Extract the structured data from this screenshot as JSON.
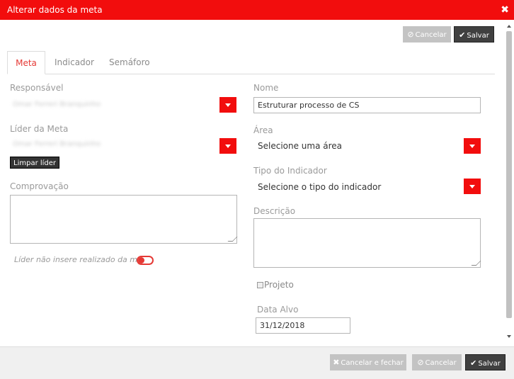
{
  "window": {
    "title": "Alterar dados da meta",
    "close_glyph": "✖"
  },
  "top_actions": {
    "cancel_label": "Cancelar",
    "save_label": "Salvar"
  },
  "tabs": [
    {
      "label": "Meta",
      "active": true
    },
    {
      "label": "Indicador",
      "active": false
    },
    {
      "label": "Semáforo",
      "active": false
    }
  ],
  "form": {
    "responsavel": {
      "label": "Responsável",
      "value": "Omar Ferreri Branquinho"
    },
    "lider": {
      "label": "Líder da Meta",
      "value": "Omar Ferreri Branquinho",
      "clear_label": "Limpar líder"
    },
    "comprovacao": {
      "label": "Comprovação",
      "value": ""
    },
    "toggle": {
      "label": "Líder não insere realizado da meta",
      "on": false
    },
    "nome": {
      "label": "Nome",
      "value": "Estruturar processo de CS"
    },
    "area": {
      "label": "Área",
      "selected": "Selecione uma área"
    },
    "tipo_indicador": {
      "label": "Tipo do Indicador",
      "selected": "Selecione o tipo do indicador"
    },
    "descricao": {
      "label": "Descrição",
      "value": ""
    },
    "projeto": {
      "label": "Projeto",
      "checked": false
    },
    "data_alvo": {
      "label": "Data Alvo",
      "value": "31/12/2018"
    }
  },
  "footer": {
    "cancel_close_label": "Cancelar e fechar",
    "cancel_label": "Cancelar",
    "save_label": "Salvar"
  },
  "colors": {
    "accent": "#f20d0d",
    "dark_button": "#404040",
    "disabled_button": "#c3c3c3"
  }
}
